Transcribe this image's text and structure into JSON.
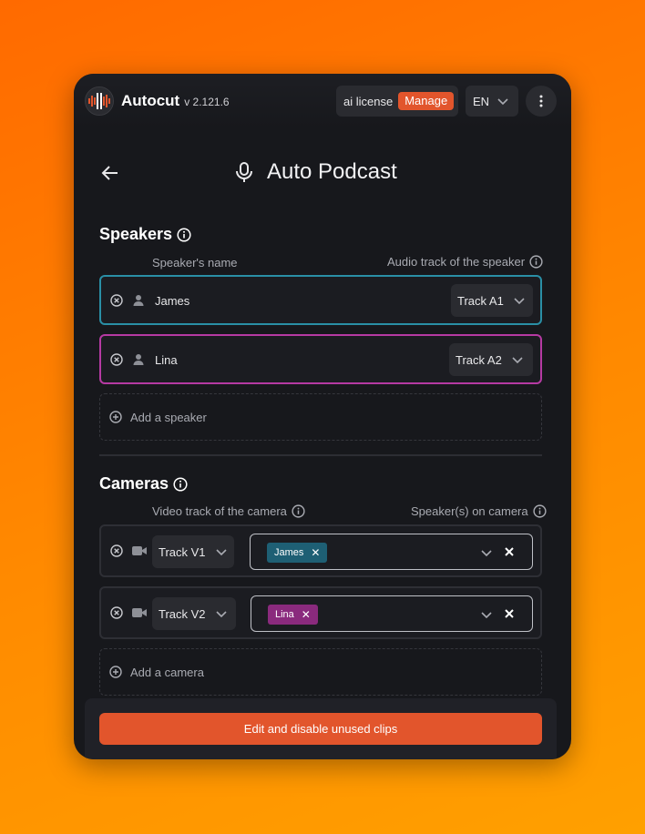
{
  "header": {
    "app_name": "Autocut",
    "version": "v 2.121.6",
    "license_label": "ai license",
    "manage_label": "Manage",
    "language": "EN"
  },
  "page": {
    "title": "Auto Podcast"
  },
  "speakers": {
    "title": "Speakers",
    "name_col": "Speaker's name",
    "track_col": "Audio track of the speaker",
    "items": [
      {
        "name": "James",
        "track": "Track A1",
        "color": "#2a8fa6"
      },
      {
        "name": "Lina",
        "track": "Track A2",
        "color": "#b63aa3"
      }
    ],
    "add_label": "Add a speaker"
  },
  "cameras": {
    "title": "Cameras",
    "track_col": "Video track of the camera",
    "speaker_col": "Speaker(s) on camera",
    "items": [
      {
        "track": "Track V1",
        "speaker": "James",
        "chip_color": "#1e5f74"
      },
      {
        "track": "Track V2",
        "speaker": "Lina",
        "chip_color": "#8a2a7d"
      }
    ],
    "add_label": "Add a camera"
  },
  "footer": {
    "cta_label": "Edit and disable unused clips"
  },
  "colors": {
    "accent": "#e2552c",
    "background": "#17181c"
  }
}
